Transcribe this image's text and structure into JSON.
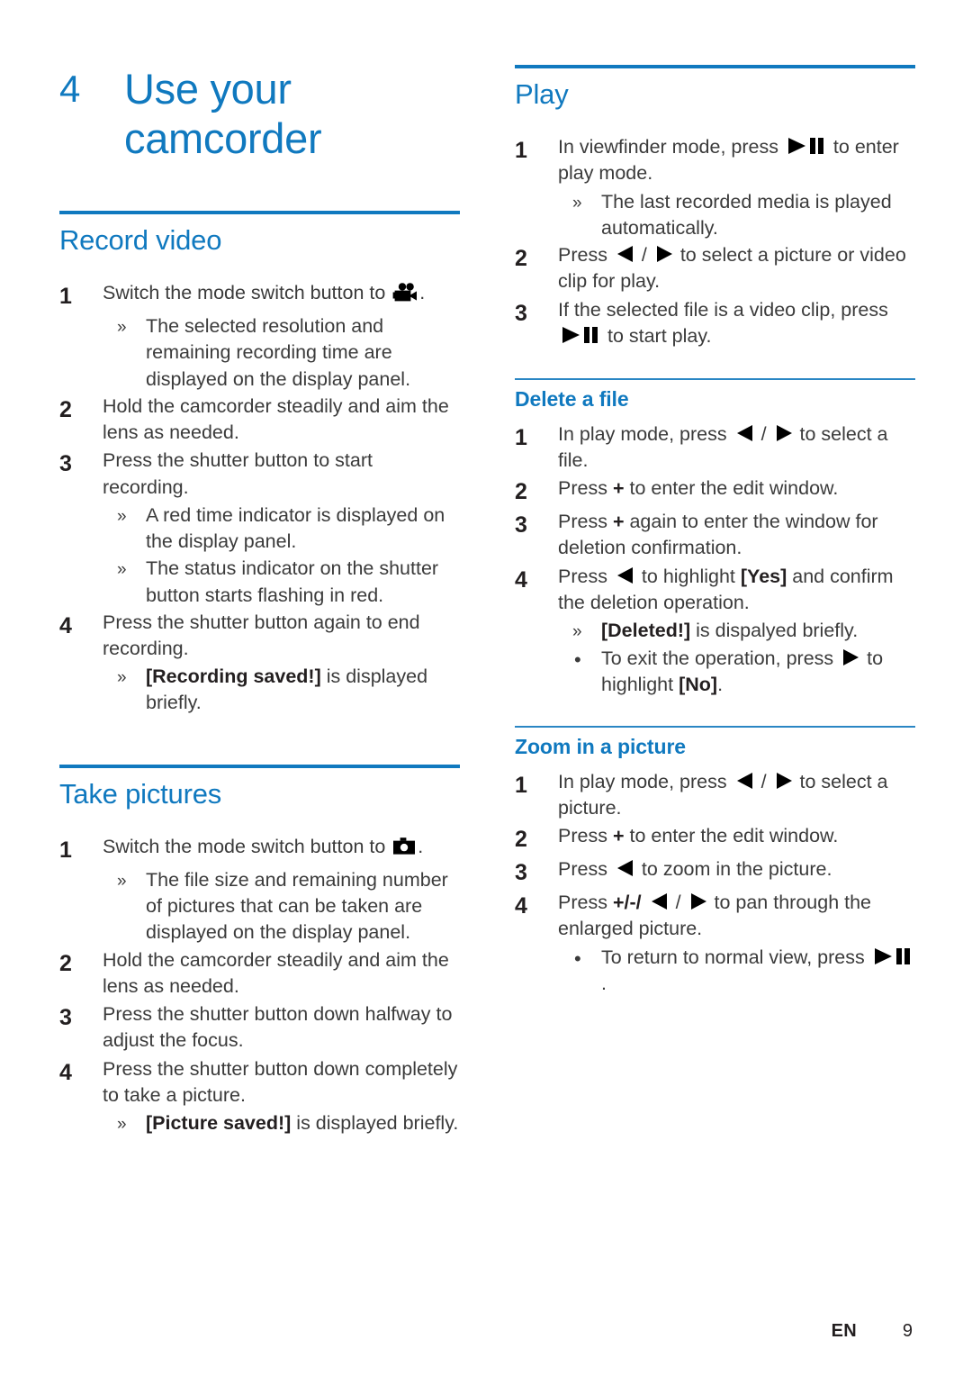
{
  "chapter": {
    "number": "4",
    "title_line1": "Use your",
    "title_line2": "camcorder"
  },
  "icons": {
    "camcorder": "camcorder-icon",
    "camera": "camera-icon",
    "play_pause": "play-pause-icon",
    "left": "left-arrow-icon",
    "right": "right-arrow-icon"
  },
  "colors": {
    "accent_blue": "#1079bf",
    "subrule_blue": "#2a86c4",
    "body_text": "#3b3b3b",
    "bold_text": "#231f20"
  },
  "left_column": {
    "sections": [
      {
        "heading": "Record video",
        "rule": "major",
        "steps": [
          {
            "num": "1",
            "parts": [
              {
                "t": "text",
                "v": "Switch the mode switch button to "
              },
              {
                "t": "icon",
                "v": "camcorder"
              },
              {
                "t": "text",
                "v": "."
              }
            ],
            "subitems": [
              {
                "marker": "»",
                "parts": [
                  {
                    "t": "text",
                    "v": "The selected resolution and remaining recording time are displayed on the display panel."
                  }
                ]
              }
            ]
          },
          {
            "num": "2",
            "parts": [
              {
                "t": "text",
                "v": "Hold the camcorder steadily and aim the lens as needed."
              }
            ],
            "subitems": []
          },
          {
            "num": "3",
            "parts": [
              {
                "t": "text",
                "v": "Press the shutter button to start recording."
              }
            ],
            "subitems": [
              {
                "marker": "»",
                "parts": [
                  {
                    "t": "text",
                    "v": "A red time indicator is displayed on the display panel."
                  }
                ]
              },
              {
                "marker": "»",
                "parts": [
                  {
                    "t": "text",
                    "v": "The status indicator on the shutter button starts flashing in red."
                  }
                ]
              }
            ]
          },
          {
            "num": "4",
            "parts": [
              {
                "t": "text",
                "v": "Press the shutter button again to end recording."
              }
            ],
            "subitems": [
              {
                "marker": "»",
                "parts": [
                  {
                    "t": "bold",
                    "v": "[Recording saved!]"
                  },
                  {
                    "t": "text",
                    "v": " is displayed briefly."
                  }
                ]
              }
            ]
          }
        ]
      },
      {
        "heading": "Take pictures",
        "rule": "major",
        "steps": [
          {
            "num": "1",
            "parts": [
              {
                "t": "text",
                "v": "Switch the mode switch button to "
              },
              {
                "t": "icon",
                "v": "camera"
              },
              {
                "t": "text",
                "v": "."
              }
            ],
            "subitems": [
              {
                "marker": "»",
                "parts": [
                  {
                    "t": "text",
                    "v": "The file size and remaining number of pictures that can be taken are displayed on the display panel."
                  }
                ]
              }
            ]
          },
          {
            "num": "2",
            "parts": [
              {
                "t": "text",
                "v": "Hold the camcorder steadily and aim the lens as needed."
              }
            ],
            "subitems": []
          },
          {
            "num": "3",
            "parts": [
              {
                "t": "text",
                "v": "Press the shutter button down halfway to adjust the focus."
              }
            ],
            "subitems": []
          },
          {
            "num": "4",
            "parts": [
              {
                "t": "text",
                "v": "Press the shutter button down completely to take a picture."
              }
            ],
            "subitems": [
              {
                "marker": "»",
                "parts": [
                  {
                    "t": "bold",
                    "v": "[Picture saved!]"
                  },
                  {
                    "t": "text",
                    "v": " is displayed briefly."
                  }
                ]
              }
            ]
          }
        ]
      }
    ]
  },
  "right_column": {
    "sections": [
      {
        "heading": "Play",
        "rule": "major",
        "steps": [
          {
            "num": "1",
            "parts": [
              {
                "t": "text",
                "v": "In viewfinder mode, press "
              },
              {
                "t": "icon",
                "v": "play_pause"
              },
              {
                "t": "text",
                "v": " to enter play mode."
              }
            ],
            "subitems": [
              {
                "marker": "»",
                "parts": [
                  {
                    "t": "text",
                    "v": "The last recorded media is played automatically."
                  }
                ]
              }
            ]
          },
          {
            "num": "2",
            "parts": [
              {
                "t": "text",
                "v": "Press "
              },
              {
                "t": "icon",
                "v": "left"
              },
              {
                "t": "text",
                "v": " / "
              },
              {
                "t": "icon",
                "v": "right"
              },
              {
                "t": "text",
                "v": " to select a picture or video clip for play."
              }
            ],
            "subitems": []
          },
          {
            "num": "3",
            "parts": [
              {
                "t": "text",
                "v": "If the selected file is a video clip, press "
              },
              {
                "t": "icon",
                "v": "play_pause"
              },
              {
                "t": "text",
                "v": " to start play."
              }
            ],
            "subitems": []
          }
        ]
      },
      {
        "heading": "Delete a file",
        "rule": "minor",
        "steps": [
          {
            "num": "1",
            "parts": [
              {
                "t": "text",
                "v": "In play mode, press "
              },
              {
                "t": "icon",
                "v": "left"
              },
              {
                "t": "text",
                "v": " / "
              },
              {
                "t": "icon",
                "v": "right"
              },
              {
                "t": "text",
                "v": " to select a file."
              }
            ],
            "subitems": []
          },
          {
            "num": "2",
            "parts": [
              {
                "t": "text",
                "v": "Press "
              },
              {
                "t": "bold",
                "v": "+"
              },
              {
                "t": "text",
                "v": " to enter the edit window."
              }
            ],
            "subitems": []
          },
          {
            "num": "3",
            "parts": [
              {
                "t": "text",
                "v": "Press "
              },
              {
                "t": "bold",
                "v": "+"
              },
              {
                "t": "text",
                "v": " again to enter the window for deletion confirmation."
              }
            ],
            "subitems": []
          },
          {
            "num": "4",
            "parts": [
              {
                "t": "text",
                "v": "Press "
              },
              {
                "t": "icon",
                "v": "left"
              },
              {
                "t": "text",
                "v": " to highlight "
              },
              {
                "t": "bold",
                "v": "[Yes]"
              },
              {
                "t": "text",
                "v": " and confirm the deletion operation."
              }
            ],
            "subitems": [
              {
                "marker": "»",
                "parts": [
                  {
                    "t": "bold",
                    "v": "[Deleted!]"
                  },
                  {
                    "t": "text",
                    "v": " is dispalyed briefly."
                  }
                ]
              },
              {
                "marker": "•",
                "parts": [
                  {
                    "t": "text",
                    "v": "To exit the operation, press "
                  },
                  {
                    "t": "icon",
                    "v": "right"
                  },
                  {
                    "t": "text",
                    "v": " to highlight "
                  },
                  {
                    "t": "bold",
                    "v": "[No]"
                  },
                  {
                    "t": "text",
                    "v": "."
                  }
                ]
              }
            ]
          }
        ]
      },
      {
        "heading": "Zoom in a picture",
        "rule": "minor",
        "steps": [
          {
            "num": "1",
            "parts": [
              {
                "t": "text",
                "v": "In play mode, press "
              },
              {
                "t": "icon",
                "v": "left"
              },
              {
                "t": "text",
                "v": " / "
              },
              {
                "t": "icon",
                "v": "right"
              },
              {
                "t": "text",
                "v": " to select a picture."
              }
            ],
            "subitems": []
          },
          {
            "num": "2",
            "parts": [
              {
                "t": "text",
                "v": "Press "
              },
              {
                "t": "bold",
                "v": "+"
              },
              {
                "t": "text",
                "v": " to enter the edit window."
              }
            ],
            "subitems": []
          },
          {
            "num": "3",
            "parts": [
              {
                "t": "text",
                "v": "Press "
              },
              {
                "t": "icon",
                "v": "left"
              },
              {
                "t": "text",
                "v": " to zoom in the picture."
              }
            ],
            "subitems": []
          },
          {
            "num": "4",
            "parts": [
              {
                "t": "text",
                "v": "Press "
              },
              {
                "t": "bold",
                "v": "+/-/"
              },
              {
                "t": "text",
                "v": " "
              },
              {
                "t": "icon",
                "v": "left"
              },
              {
                "t": "text",
                "v": " / "
              },
              {
                "t": "icon",
                "v": "right"
              },
              {
                "t": "text",
                "v": " to pan through the enlarged picture."
              }
            ],
            "subitems": [
              {
                "marker": "•",
                "parts": [
                  {
                    "t": "text",
                    "v": "To return to normal view, press "
                  },
                  {
                    "t": "icon",
                    "v": "play_pause"
                  },
                  {
                    "t": "text",
                    "v": "."
                  }
                ]
              }
            ]
          }
        ]
      }
    ]
  },
  "footer": {
    "language": "EN",
    "page_number": "9"
  }
}
